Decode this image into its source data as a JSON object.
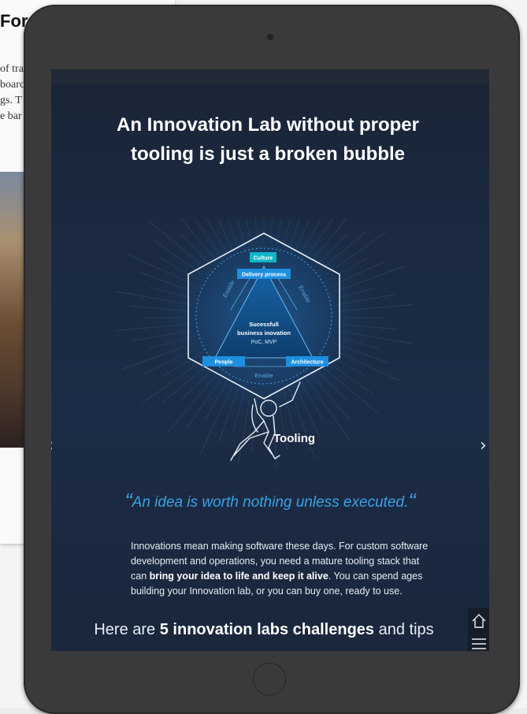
{
  "background_page": {
    "title_fragment": "For",
    "text_lines": [
      "of tra",
      "boarc",
      "gs. T",
      "e bar"
    ]
  },
  "slide": {
    "headline_line1": "An Innovation Lab without proper",
    "headline_line2": "tooling is just a broken bubble",
    "diagram": {
      "culture": "Culture",
      "delivery": "Delivery process",
      "center_line1": "Sucessfull",
      "center_line2": "business inovation",
      "center_line3": "PoC, MVP",
      "people": "People",
      "architecture": "Architecture",
      "enable_left": "Enable",
      "enable_right": "Enable",
      "enable_bottom": "Enable",
      "tooling": "Tooling"
    },
    "quote": "An idea is worth nothing unless executed.",
    "body_part1": "Innovations mean making software these days. For custom software development and operations, you need a mature tooling stack that can ",
    "body_bold": "bring your idea to life and keep it alive",
    "body_part2": ". You can spend ages building your Innovation lab, or you can buy one, ready to use.",
    "challenges_pre": "Here are ",
    "challenges_bold": "5 innovation labs challenges",
    "challenges_post": " and tips"
  },
  "icons": {
    "prev": "chevron-left-icon",
    "next": "chevron-right-icon",
    "home": "home-icon",
    "menu": "menu-icon"
  },
  "colors": {
    "screen_bg": "#1c2c46",
    "accent_blue": "#1e8fe0",
    "culture_teal": "#12b5c9",
    "quote_blue": "#3aa2e6"
  }
}
